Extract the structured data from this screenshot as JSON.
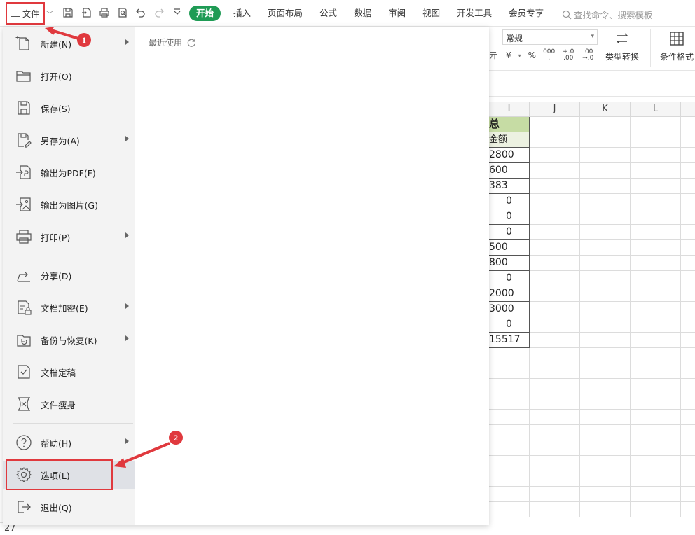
{
  "toolbar": {
    "file_label": "文件",
    "tabs": [
      "开始",
      "插入",
      "页面布局",
      "公式",
      "数据",
      "审阅",
      "视图",
      "开发工具",
      "会员专享"
    ],
    "search_placeholder": "查找命令、搜索模板"
  },
  "ribbon": {
    "number_format": "常规",
    "currency_symbol": "¥",
    "percent_symbol": "%",
    "thousands_symbol": "000",
    "comma_symbol": ",",
    "increase_decimal": "+.0 .00",
    "decrease_decimal": ".00 →.0",
    "convert_label": "类型转换",
    "conditional_label": "条件格式",
    "partial_char": "亓"
  },
  "file_menu": {
    "items": [
      {
        "label": "新建(N)",
        "icon": "new-file-icon",
        "submenu": true
      },
      {
        "label": "打开(O)",
        "icon": "folder-open-icon",
        "submenu": false
      },
      {
        "label": "保存(S)",
        "icon": "save-icon",
        "submenu": false
      },
      {
        "label": "另存为(A)",
        "icon": "save-as-icon",
        "submenu": true
      },
      {
        "label": "输出为PDF(F)",
        "icon": "export-pdf-icon",
        "submenu": false
      },
      {
        "label": "输出为图片(G)",
        "icon": "export-image-icon",
        "submenu": false
      },
      {
        "label": "打印(P)",
        "icon": "print-icon",
        "submenu": true
      },
      {
        "label": "分享(D)",
        "icon": "share-icon",
        "submenu": false
      },
      {
        "label": "文档加密(E)",
        "icon": "encrypt-icon",
        "submenu": true
      },
      {
        "label": "备份与恢复(K)",
        "icon": "backup-restore-icon",
        "submenu": true
      },
      {
        "label": "文档定稿",
        "icon": "finalize-icon",
        "submenu": false
      },
      {
        "label": "文件瘦身",
        "icon": "slim-file-icon",
        "submenu": false
      },
      {
        "label": "帮助(H)",
        "icon": "help-icon",
        "submenu": true
      },
      {
        "label": "选项(L)",
        "icon": "gear-icon",
        "submenu": false
      },
      {
        "label": "退出(Q)",
        "icon": "exit-icon",
        "submenu": false
      }
    ],
    "recent_label": "最近使用"
  },
  "sheet": {
    "columns": [
      "I",
      "J",
      "K",
      "L"
    ],
    "header_cell": "总",
    "subheader_cell": "金额",
    "values": [
      "2800",
      "600",
      "383",
      "0",
      "0",
      "0",
      "500",
      "800",
      "0",
      "2000",
      "3000",
      "0",
      "15517"
    ],
    "row_label": "27"
  },
  "annotations": {
    "badge1": "1",
    "badge2": "2"
  },
  "colors": {
    "accent_green": "#1f9b55",
    "annotation_red": "#e0393e",
    "header_green": "#c6dca4"
  }
}
